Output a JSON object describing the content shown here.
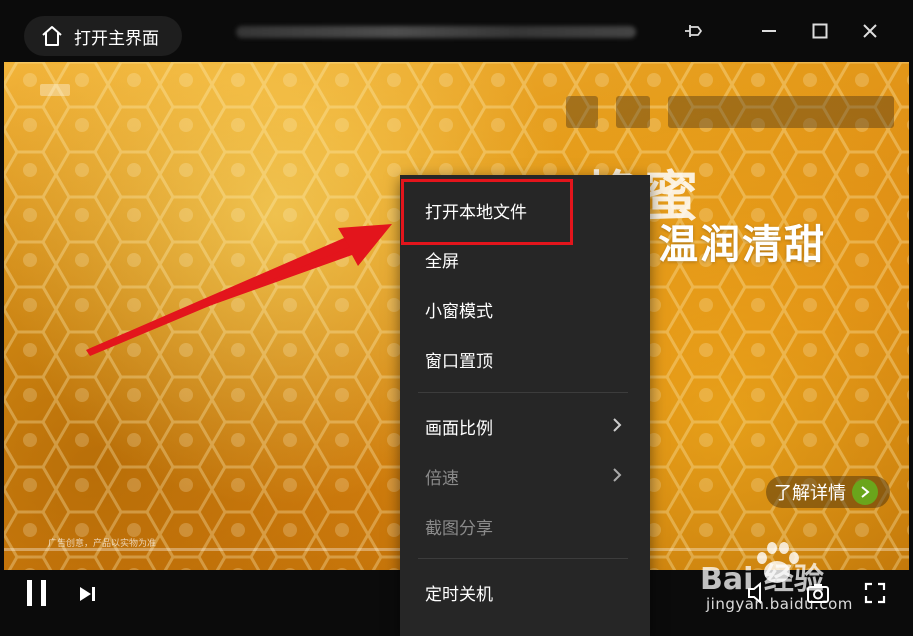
{
  "titlebar": {
    "home_label": "打开主界面",
    "icons": [
      "home-icon",
      "pin-icon",
      "minimize-icon",
      "maximize-icon",
      "close-icon"
    ]
  },
  "video": {
    "promo_title": "蜂蜜",
    "promo_subtitle": "温润清甜",
    "learn_more": "了解详情",
    "disclaimer": "广告创意，产品以实物为准"
  },
  "context_menu": {
    "items": [
      {
        "label": "打开本地文件",
        "enabled": true
      },
      {
        "label": "全屏",
        "enabled": true
      },
      {
        "label": "小窗模式",
        "enabled": true
      },
      {
        "label": "窗口置顶",
        "enabled": true
      },
      {
        "label": "画面比例",
        "enabled": true,
        "submenu": true
      },
      {
        "label": "倍速",
        "enabled": false,
        "submenu": true
      },
      {
        "label": "截图分享",
        "enabled": false
      },
      {
        "label": "定时关机",
        "enabled": true
      }
    ]
  },
  "controls": {
    "icons": [
      "pause-icon",
      "next-icon",
      "volume-icon",
      "screenshot-icon",
      "fullscreen-icon"
    ]
  },
  "annotation": {
    "highlight_color": "#e3151c",
    "arrow_color": "#e3151c"
  },
  "watermark": {
    "logo": "Bai 经验",
    "url": "jingyan.baidu.com"
  }
}
